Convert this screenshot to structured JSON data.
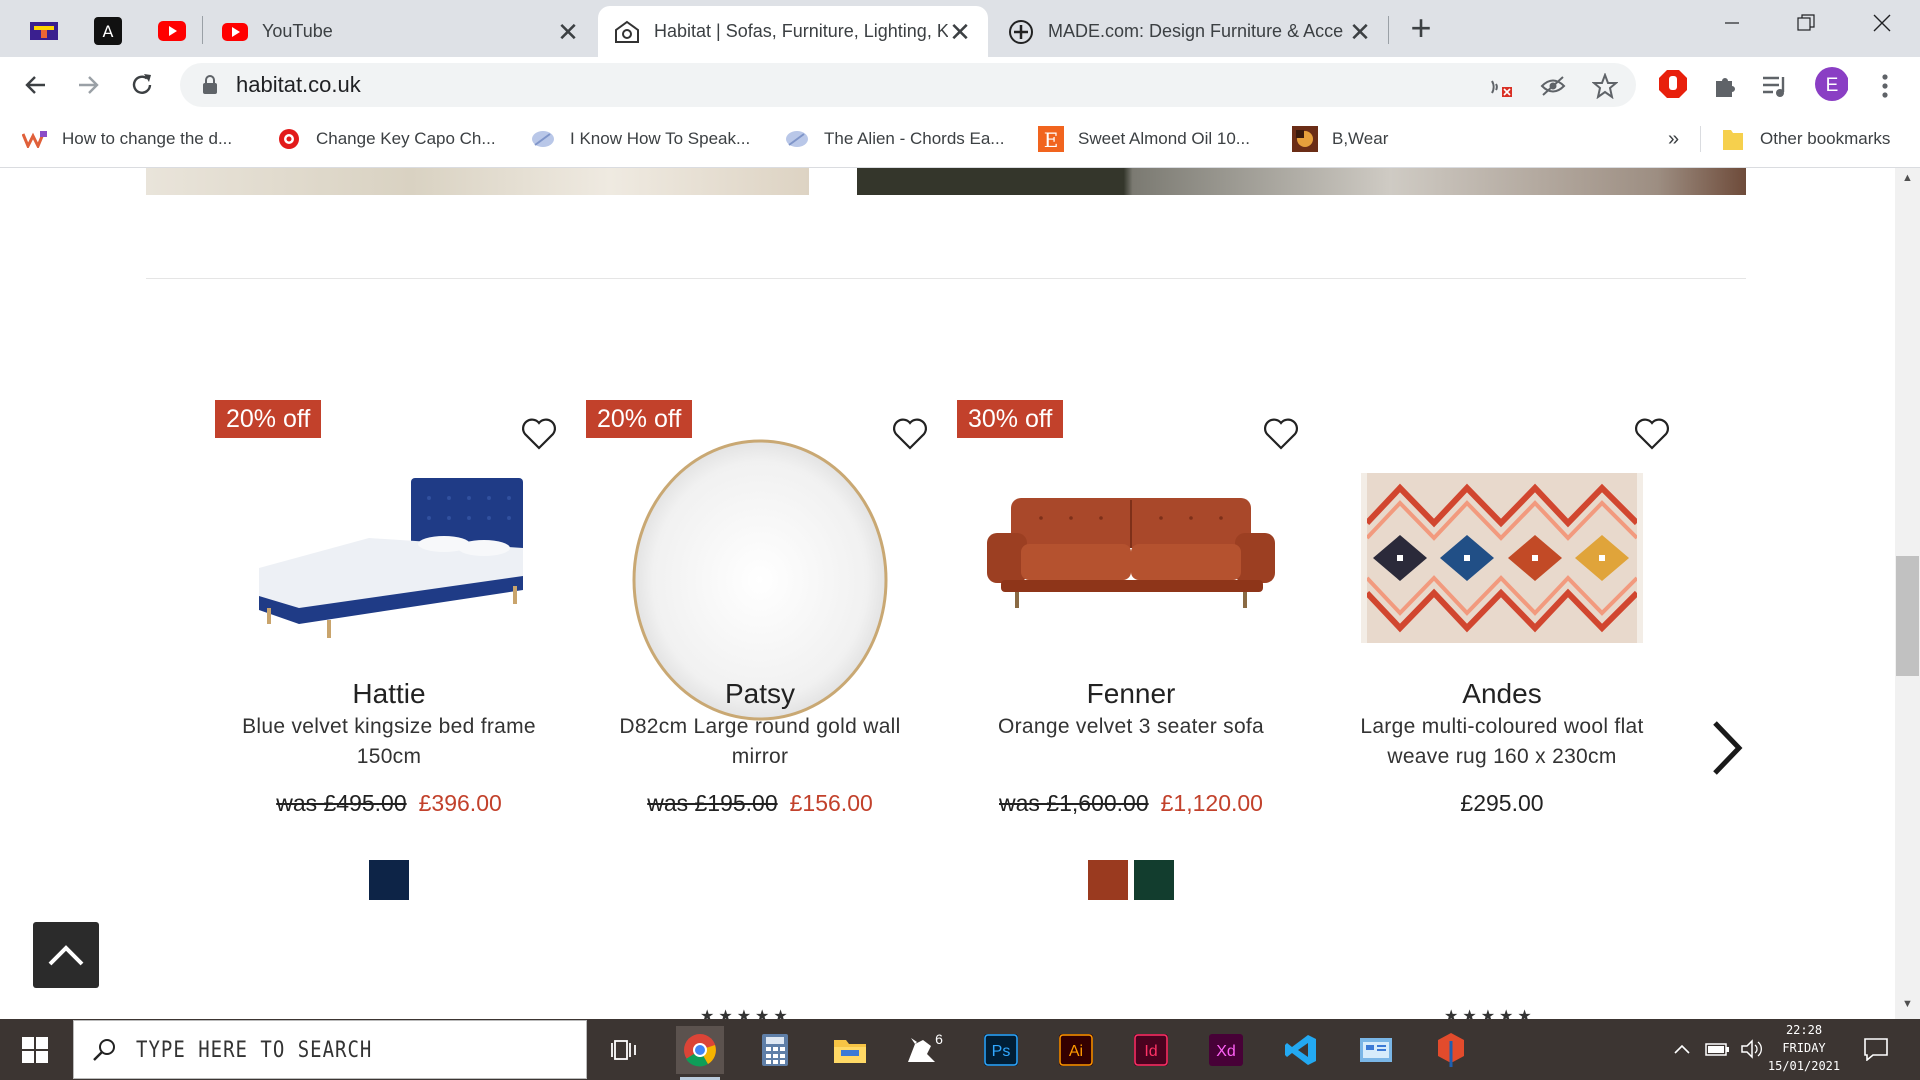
{
  "browser": {
    "tabs": [
      {
        "title": "YouTube",
        "active": false
      },
      {
        "title": "Habitat | Sofas, Furniture, Lighting, K",
        "active": true
      },
      {
        "title": "MADE.com: Design Furniture & Acce",
        "active": false
      }
    ],
    "close_glyph": "✕",
    "new_tab_glyph": "+",
    "url": "habitat.co.uk",
    "profile_initial": "E",
    "bookmarks": [
      "How to change the d...",
      "Change Key Capo Ch...",
      "I Know How To Speak...",
      "The Alien - Chords Ea...",
      "Sweet Almond Oil 10...",
      "B,Wear"
    ],
    "bookmark_overflow": "»",
    "other_bookmarks": "Other bookmarks"
  },
  "products": [
    {
      "badge": "20% off",
      "name": "Hattie",
      "description": "Blue velvet kingsize bed frame 150cm",
      "was": "was £495.00",
      "price": "£396.00",
      "swatches": [
        "#0d2447"
      ]
    },
    {
      "badge": "20% off",
      "name": "Patsy",
      "description": "D82cm Large round gold wall mirror",
      "was": "was £195.00",
      "price": "£156.00",
      "swatches": []
    },
    {
      "badge": "30% off",
      "name": "Fenner",
      "description": "Orange velvet 3 seater sofa",
      "was": "was £1,600.00",
      "price": "£1,120.00",
      "swatches": [
        "#9a3a1f",
        "#123d2e"
      ]
    },
    {
      "badge": "",
      "name": "Andes",
      "description": "Large multi-coloured wool flat weave rug 160 x 230cm",
      "was": "",
      "price": "£295.00",
      "swatches": []
    }
  ],
  "colors": {
    "sale": "#c2412b",
    "taskbar": "#3c3532"
  },
  "taskbar": {
    "search_placeholder": "TYPE HERE TO SEARCH",
    "apps": [
      "task-view",
      "chrome",
      "calculator",
      "file-explorer",
      "rhino-6",
      "photoshop",
      "illustrator",
      "indesign",
      "adobe-xd",
      "vscode",
      "control-panel",
      "sketchup"
    ],
    "app_labels": {
      "rhino": "6",
      "photoshop": "Ps",
      "illustrator": "Ai",
      "indesign": "Id",
      "xd": "Xd"
    },
    "clock_time": "22:28",
    "clock_day": "FRIDAY",
    "clock_date": "15/01/2021"
  }
}
